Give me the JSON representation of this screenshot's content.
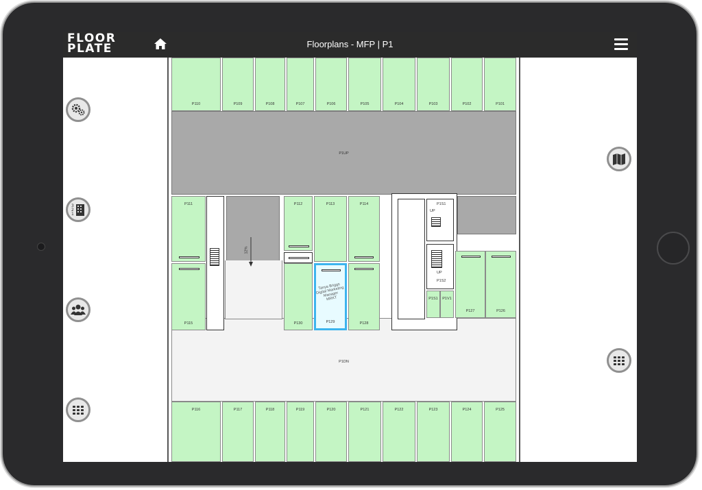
{
  "app": {
    "logo_line1": "FLOOR",
    "logo_line2": "PLATE",
    "title": "Floorplans - MFP | P1",
    "accent": "#3cb4ee",
    "room_color": "#c4f5c4",
    "bar_color": "#2b2b2b"
  },
  "icons": {
    "home": "home-icon",
    "menu": "hamburger-menu-icon",
    "left": [
      "gears-icon",
      "building-floors-icon",
      "people-group-icon",
      "grid-icon"
    ],
    "right": [
      "map-icon",
      "grid-icon"
    ]
  },
  "rooms_top": [
    "P110",
    "P109",
    "P108",
    "P107",
    "P106",
    "P105",
    "P104",
    "P103",
    "P102",
    "P101"
  ],
  "rooms_bottom": [
    "P116",
    "P117",
    "P118",
    "P119",
    "P120",
    "P121",
    "P122",
    "P123",
    "P124",
    "P125"
  ],
  "rooms_mid": {
    "p111": "P111",
    "p112": "P112",
    "p113": "P113",
    "p114": "P114",
    "p115": "P115",
    "p130": "P130",
    "p129": "P129",
    "p128": "P128",
    "p127": "P127",
    "p126": "P126"
  },
  "selected_room": {
    "name": "Tanya Briggs",
    "role": "Digital Marketing Manager",
    "extra": "MRKT",
    "label": "P129"
  },
  "zones": {
    "upper_corridor": "P1UP",
    "lower_corridor": "P1DN",
    "stair1": "P1S1",
    "stair2": "P1S2",
    "s3": "P1S1",
    "v1": "P1V1",
    "up1": "UP",
    "up2": "UP",
    "ramp": "12%"
  }
}
